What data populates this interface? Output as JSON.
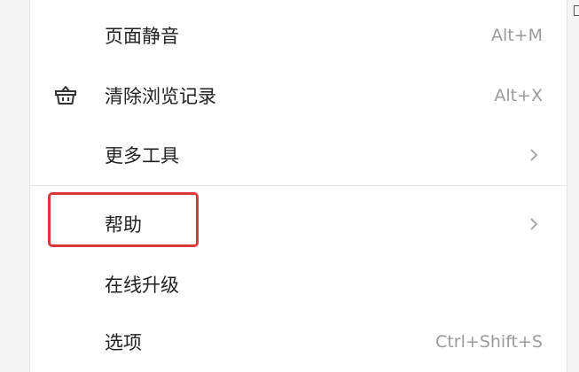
{
  "menu": {
    "items": [
      {
        "label": "页面静音",
        "shortcut": "Alt+M"
      },
      {
        "label": "清除浏览记录",
        "shortcut": "Alt+X",
        "icon": "basket-icon"
      },
      {
        "label": "更多工具",
        "submenu": true
      },
      {
        "label": "帮助",
        "submenu": true,
        "highlighted": true
      },
      {
        "label": "在线升级"
      },
      {
        "label": "选项",
        "shortcut": "Ctrl+Shift+S"
      }
    ]
  },
  "colors": {
    "highlight_border": "#d83a3a",
    "text": "#222222",
    "shortcut_text": "#9a9a9a"
  }
}
